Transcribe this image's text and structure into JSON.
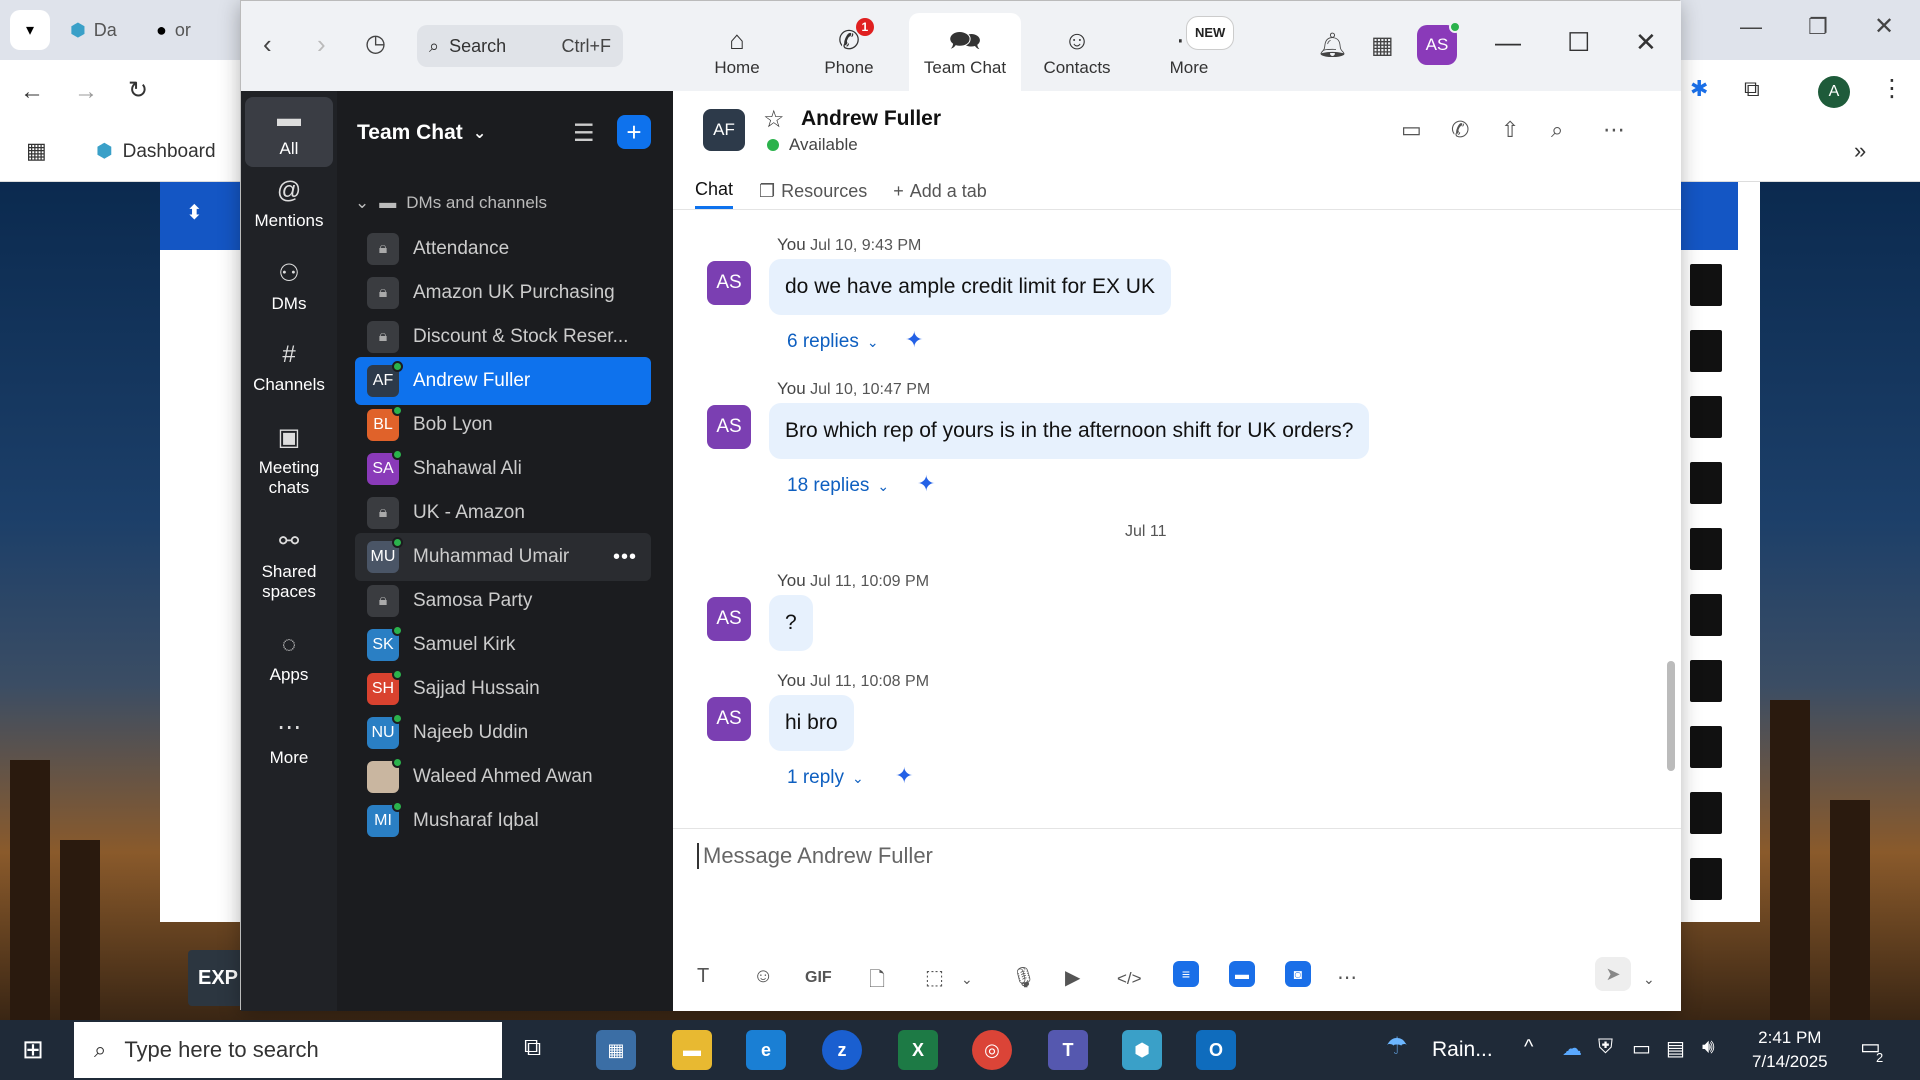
{
  "browser": {
    "tabs": [
      {
        "label": "Da"
      },
      {
        "label": "or"
      }
    ],
    "bookmark": "Dashboard",
    "profile_initial": "A",
    "exp_button": "EXP"
  },
  "zoom": {
    "search": {
      "placeholder": "Search",
      "shortcut": "Ctrl+F"
    },
    "nav_tabs": [
      {
        "label": "Home",
        "icon": "home-icon"
      },
      {
        "label": "Phone",
        "icon": "phone-icon",
        "badge": "1"
      },
      {
        "label": "Team Chat",
        "icon": "chat-icon"
      },
      {
        "label": "Contacts",
        "icon": "contacts-icon"
      },
      {
        "label": "More",
        "icon": "more-icon",
        "badge": "NEW"
      }
    ],
    "user_initials": "AS",
    "rail": [
      {
        "label": "All"
      },
      {
        "label": "Mentions"
      },
      {
        "label": "DMs"
      },
      {
        "label": "Channels"
      },
      {
        "label": "Meeting chats"
      },
      {
        "label": "Shared spaces"
      },
      {
        "label": "Apps"
      },
      {
        "label": "More"
      }
    ],
    "panel": {
      "title": "Team Chat",
      "section": "DMs and channels",
      "items": [
        {
          "label": "Attendance",
          "type": "channel"
        },
        {
          "label": "Amazon UK Purchasing",
          "type": "channel"
        },
        {
          "label": "Discount & Stock Reser...",
          "type": "channel"
        },
        {
          "label": "Andrew Fuller",
          "initials": "AF",
          "color": "#2d3a4a"
        },
        {
          "label": "Bob Lyon",
          "initials": "BL",
          "color": "#e0622a"
        },
        {
          "label": "Shahawal Ali",
          "initials": "SA",
          "color": "#8a3ab9"
        },
        {
          "label": "UK - Amazon",
          "type": "channel"
        },
        {
          "label": "Muhammad Umair",
          "initials": "MU",
          "color": "#4a5566"
        },
        {
          "label": "Samosa Party",
          "type": "channel"
        },
        {
          "label": "Samuel Kirk",
          "initials": "SK",
          "color": "#2a7fc4"
        },
        {
          "label": "Sajjad Hussain",
          "initials": "SH",
          "color": "#d9422f"
        },
        {
          "label": "Najeeb Uddin",
          "initials": "NU",
          "color": "#2a7fc4"
        },
        {
          "label": "Waleed Ahmed Awan",
          "initials": "",
          "color": "#c9b6a0"
        },
        {
          "label": "Musharaf Iqbal",
          "initials": "MI",
          "color": "#2a7fc4"
        }
      ]
    },
    "chat": {
      "contact_initials": "AF",
      "contact_name": "Andrew Fuller",
      "status": "Available",
      "tabs": [
        {
          "label": "Chat"
        },
        {
          "label": "Resources"
        },
        {
          "label": "Add a tab"
        }
      ],
      "date_separator": "Jul 11",
      "messages": [
        {
          "sender": "You",
          "time": "Jul 10, 9:43 PM",
          "text": "do we have ample credit limit for EX UK",
          "replies": "6 replies",
          "initials": "AS"
        },
        {
          "sender": "You",
          "time": "Jul 10, 10:47 PM",
          "text": "Bro which rep of yours is in the afternoon shift for UK orders?",
          "replies": "18 replies",
          "initials": "AS"
        },
        {
          "sender": "You",
          "time": "Jul 11, 10:09 PM",
          "text": "?",
          "initials": "AS"
        },
        {
          "sender": "You",
          "time": "Jul 11, 10:08 PM",
          "text": "hi bro",
          "replies": "1 reply",
          "initials": "AS"
        }
      ],
      "compose_placeholder": "Message Andrew Fuller"
    }
  },
  "taskbar": {
    "search_placeholder": "Type here to search",
    "weather": "Rain...",
    "time": "2:41 PM",
    "date": "7/14/2025",
    "notification_count": "2"
  }
}
